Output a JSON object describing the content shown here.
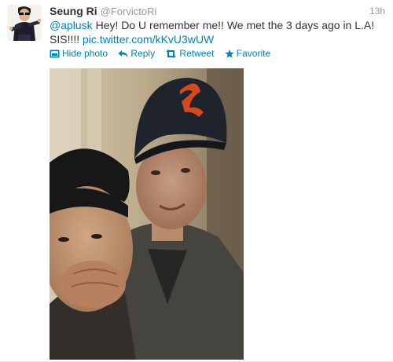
{
  "tweet": {
    "name": "Seung Ri",
    "handle": "@ForvictoRi",
    "time": "13h",
    "mention": "@aplusk",
    "text_main": " Hey! Do U remember me!! We met the 3 days ago in L.A!",
    "text_tail": "SIS!!!! ",
    "link": "pic.twitter.com/kKvU3wUW"
  },
  "actions": {
    "hide_photo": "Hide photo",
    "reply": "Reply",
    "retweet": "Retweet",
    "favorite": "Favorite"
  },
  "icons": {
    "hide_photo": "photo-icon",
    "reply": "reply-arrow-icon",
    "retweet": "retweet-icon",
    "favorite": "star-icon"
  },
  "colors": {
    "link": "#0084b4",
    "name": "#333333",
    "meta": "#999999",
    "cap_logo": "#e8501e"
  }
}
